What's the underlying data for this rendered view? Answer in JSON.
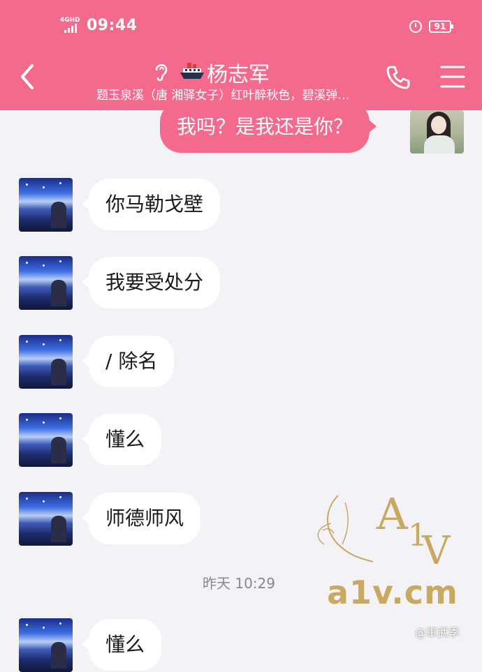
{
  "status": {
    "time": "09:44",
    "network": "4GHD",
    "battery": "91"
  },
  "header": {
    "title": "杨志军",
    "subtitle": "题玉泉溪（唐 湘驿女子）红叶醉秋色，碧溪弹…",
    "icons": [
      "back-icon",
      "ear-icon",
      "ship-icon",
      "phone-icon",
      "menu-icon"
    ]
  },
  "messages": [
    {
      "side": "out",
      "text": "我吗？是我还是你？"
    },
    {
      "side": "in",
      "text": "你马勒戈壁"
    },
    {
      "side": "in",
      "text": "我要受处分"
    },
    {
      "side": "in",
      "text": "/ 除名"
    },
    {
      "side": "in",
      "text": "懂么"
    },
    {
      "side": "in",
      "text": "师德师风"
    },
    {
      "side": "in",
      "text": "懂么"
    }
  ],
  "timestamp": "昨天 10:29",
  "watermark": {
    "logo": "A1V",
    "site": "a1v.cm",
    "weibo": "@軍武季"
  },
  "colors": {
    "accent": "#f46a8c",
    "background": "#f3f3f7",
    "watermark": "#c9a85f"
  }
}
